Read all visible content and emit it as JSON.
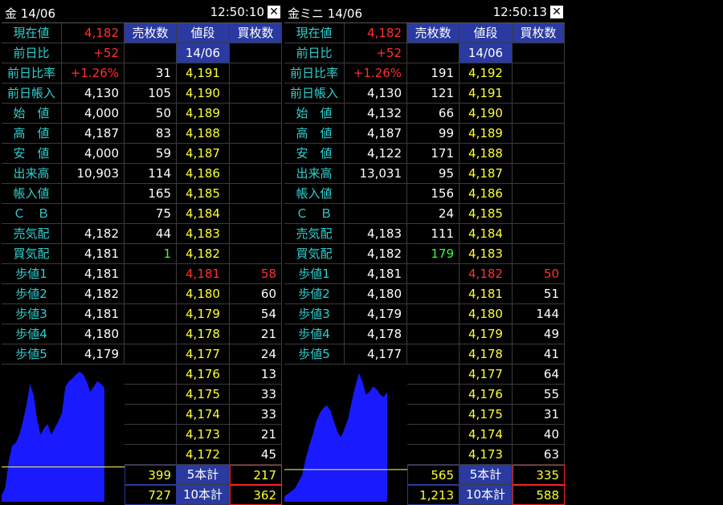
{
  "panels": [
    {
      "title": "金 14/06",
      "time": "12:50:10",
      "headers": {
        "sell": "売枚数",
        "price": "値段",
        "buy": "買枚数",
        "date": "14/06"
      },
      "info": [
        {
          "label": "現在値",
          "value": "4,182",
          "red": true
        },
        {
          "label": "前日比",
          "value": "+52",
          "red": true
        },
        {
          "label": "前日比率",
          "value": "+1.26%",
          "red": true
        },
        {
          "label": "前日帳入",
          "value": "4,130"
        },
        {
          "label": "始　値",
          "value": "4,000"
        },
        {
          "label": "高　値",
          "value": "4,187"
        },
        {
          "label": "安　値",
          "value": "4,000"
        },
        {
          "label": "出来高",
          "value": "10,903"
        },
        {
          "label": "帳入値",
          "value": ""
        },
        {
          "label": "Ｃ　Ｂ",
          "value": ""
        },
        {
          "label": "売気配",
          "value": "4,182"
        },
        {
          "label": "買気配",
          "value": "4,181"
        },
        {
          "label": "歩値1",
          "value": "4,181"
        },
        {
          "label": "歩値2",
          "value": "4,182"
        },
        {
          "label": "歩値3",
          "value": "4,181"
        },
        {
          "label": "歩値4",
          "value": "4,180"
        },
        {
          "label": "歩値5",
          "value": "4,179"
        }
      ],
      "book": [
        {
          "sell": "31",
          "price": "4,191",
          "buy": ""
        },
        {
          "sell": "105",
          "price": "4,190",
          "buy": ""
        },
        {
          "sell": "50",
          "price": "4,189",
          "buy": ""
        },
        {
          "sell": "83",
          "price": "4,188",
          "buy": ""
        },
        {
          "sell": "59",
          "price": "4,187",
          "buy": ""
        },
        {
          "sell": "114",
          "price": "4,186",
          "buy": ""
        },
        {
          "sell": "165",
          "price": "4,185",
          "buy": ""
        },
        {
          "sell": "75",
          "price": "4,184",
          "buy": ""
        },
        {
          "sell": "44",
          "price": "4,183",
          "buy": ""
        },
        {
          "sell": "1",
          "price": "4,182",
          "buy": "",
          "sell_green": true
        },
        {
          "sell": "",
          "price": "4,181",
          "buy": "58",
          "price_red": true,
          "buy_red": true
        },
        {
          "sell": "",
          "price": "4,180",
          "buy": "60"
        },
        {
          "sell": "",
          "price": "4,179",
          "buy": "54"
        },
        {
          "sell": "",
          "price": "4,178",
          "buy": "21"
        },
        {
          "sell": "",
          "price": "4,177",
          "buy": "24"
        },
        {
          "sell": "",
          "price": "4,176",
          "buy": "13"
        },
        {
          "sell": "",
          "price": "4,175",
          "buy": "33"
        },
        {
          "sell": "",
          "price": "4,174",
          "buy": "33"
        },
        {
          "sell": "",
          "price": "4,173",
          "buy": "21"
        },
        {
          "sell": "",
          "price": "4,172",
          "buy": "45"
        }
      ],
      "totals": [
        {
          "sell": "399",
          "label": "5本計",
          "buy": "217"
        },
        {
          "sell": "727",
          "label": "10本計",
          "buy": "362"
        }
      ],
      "chart": [
        0.05,
        0.1,
        0.3,
        0.42,
        0.44,
        0.5,
        0.6,
        0.72,
        0.88,
        0.8,
        0.62,
        0.5,
        0.55,
        0.58,
        0.5,
        0.55,
        0.6,
        0.66,
        0.86,
        0.9,
        0.92,
        0.95,
        0.97,
        0.95,
        0.9,
        0.82,
        0.86,
        0.9,
        0.88,
        0.85
      ],
      "chart_ref": 0.26
    },
    {
      "title": "金ミニ 14/06",
      "time": "12:50:13",
      "headers": {
        "sell": "売枚数",
        "price": "値段",
        "buy": "買枚数",
        "date": "14/06"
      },
      "info": [
        {
          "label": "現在値",
          "value": "4,182",
          "red": true
        },
        {
          "label": "前日比",
          "value": "+52",
          "red": true
        },
        {
          "label": "前日比率",
          "value": "+1.26%",
          "red": true
        },
        {
          "label": "前日帳入",
          "value": "4,130"
        },
        {
          "label": "始　値",
          "value": "4,132"
        },
        {
          "label": "高　値",
          "value": "4,187"
        },
        {
          "label": "安　値",
          "value": "4,122"
        },
        {
          "label": "出来高",
          "value": "13,031"
        },
        {
          "label": "帳入値",
          "value": ""
        },
        {
          "label": "Ｃ　Ｂ",
          "value": ""
        },
        {
          "label": "売気配",
          "value": "4,183"
        },
        {
          "label": "買気配",
          "value": "4,182"
        },
        {
          "label": "歩値1",
          "value": "4,181"
        },
        {
          "label": "歩値2",
          "value": "4,180"
        },
        {
          "label": "歩値3",
          "value": "4,179"
        },
        {
          "label": "歩値4",
          "value": "4,178"
        },
        {
          "label": "歩値5",
          "value": "4,177"
        }
      ],
      "book": [
        {
          "sell": "191",
          "price": "4,192",
          "buy": ""
        },
        {
          "sell": "121",
          "price": "4,191",
          "buy": ""
        },
        {
          "sell": "66",
          "price": "4,190",
          "buy": ""
        },
        {
          "sell": "99",
          "price": "4,189",
          "buy": ""
        },
        {
          "sell": "171",
          "price": "4,188",
          "buy": ""
        },
        {
          "sell": "95",
          "price": "4,187",
          "buy": ""
        },
        {
          "sell": "156",
          "price": "4,186",
          "buy": ""
        },
        {
          "sell": "24",
          "price": "4,185",
          "buy": ""
        },
        {
          "sell": "111",
          "price": "4,184",
          "buy": ""
        },
        {
          "sell": "179",
          "price": "4,183",
          "buy": "",
          "sell_green": true
        },
        {
          "sell": "",
          "price": "4,182",
          "buy": "50",
          "price_red": true,
          "buy_red": true
        },
        {
          "sell": "",
          "price": "4,181",
          "buy": "51"
        },
        {
          "sell": "",
          "price": "4,180",
          "buy": "144"
        },
        {
          "sell": "",
          "price": "4,179",
          "buy": "49"
        },
        {
          "sell": "",
          "price": "4,178",
          "buy": "41"
        },
        {
          "sell": "",
          "price": "4,177",
          "buy": "64"
        },
        {
          "sell": "",
          "price": "4,176",
          "buy": "55"
        },
        {
          "sell": "",
          "price": "4,175",
          "buy": "31"
        },
        {
          "sell": "",
          "price": "4,174",
          "buy": "40"
        },
        {
          "sell": "",
          "price": "4,173",
          "buy": "63"
        }
      ],
      "totals": [
        {
          "sell": "565",
          "label": "5本計",
          "buy": "335"
        },
        {
          "sell": "1,213",
          "label": "10本計",
          "buy": "588"
        }
      ],
      "chart": [
        0.04,
        0.06,
        0.08,
        0.1,
        0.15,
        0.2,
        0.32,
        0.42,
        0.5,
        0.6,
        0.66,
        0.7,
        0.72,
        0.68,
        0.6,
        0.52,
        0.48,
        0.55,
        0.62,
        0.75,
        0.86,
        0.96,
        0.9,
        0.8,
        0.82,
        0.86,
        0.84,
        0.8,
        0.78,
        0.82
      ],
      "chart_ref": 0.24
    }
  ]
}
